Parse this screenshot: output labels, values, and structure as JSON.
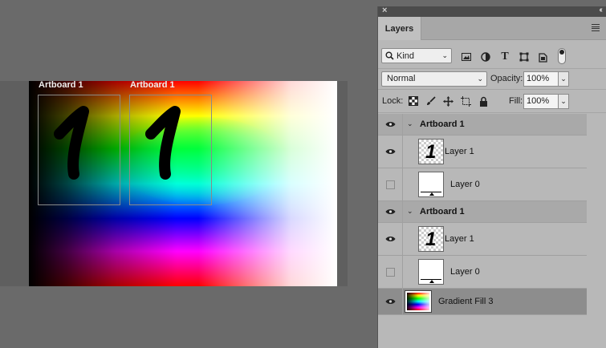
{
  "canvas": {
    "artboards": [
      {
        "label": "Artboard 1",
        "digit": "1"
      },
      {
        "label": "Artboard 1",
        "digit": "1"
      }
    ]
  },
  "panel": {
    "tab_label": "Layers",
    "close_glyph": "×",
    "collapse_glyph": "‹‹",
    "filter": {
      "kind_label": "Kind"
    },
    "blend": {
      "mode": "Normal",
      "opacity_label": "Opacity:",
      "opacity_value": "100%",
      "lock_label": "Lock:",
      "fill_label": "Fill:",
      "fill_value": "100%"
    },
    "layers": [
      {
        "type": "group",
        "name": "Artboard 1",
        "visible": true
      },
      {
        "type": "layer",
        "name": "Layer 1",
        "visible": true,
        "thumb": "digit",
        "thumb_text": "1"
      },
      {
        "type": "layer",
        "name": "Layer 0",
        "visible": false,
        "thumb": "artboard"
      },
      {
        "type": "group",
        "name": "Artboard 1",
        "visible": true
      },
      {
        "type": "layer",
        "name": "Layer 1",
        "visible": true,
        "thumb": "digit",
        "thumb_text": "1"
      },
      {
        "type": "layer",
        "name": "Layer 0",
        "visible": false,
        "thumb": "artboard"
      },
      {
        "type": "fill",
        "name": "Gradient Fill 3",
        "visible": true,
        "selected": true
      }
    ]
  },
  "colors": {
    "panel_bg": "#b8b8b8",
    "selected_row": "#8d8d8d",
    "canvas_bg": "#6a6a6a"
  }
}
